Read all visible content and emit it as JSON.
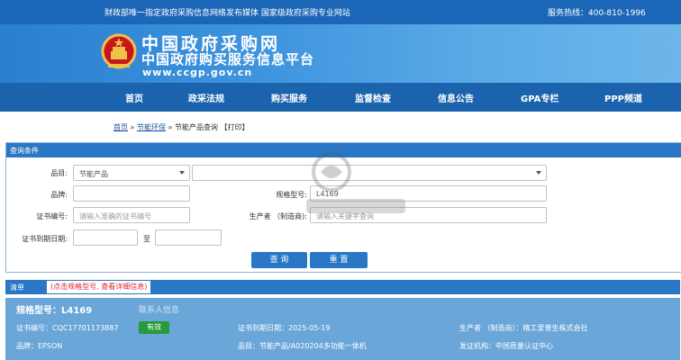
{
  "topbar": {
    "notice": "财政部唯一指定政府采购信息网络发布媒体 国家级政府采购专业网站",
    "hotline": "服务热线：400-810-1996"
  },
  "banner": {
    "title": "中国政府采购网",
    "subtitle": "中国政府购买服务信息平台",
    "url": "www.ccgp.gov.cn"
  },
  "nav": {
    "items": [
      "首页",
      "政采法规",
      "购买服务",
      "监督检查",
      "信息公告",
      "GPA专栏",
      "PPP频道"
    ]
  },
  "breadcrumb": {
    "home": "首页",
    "sep1": "»",
    "section": "节能环保",
    "sep2": "»",
    "page": "节能产品查询",
    "print": "【打印】"
  },
  "query": {
    "header": "查询条件",
    "category_label": "品目:",
    "category_value": "节能产品",
    "subcategory_value": "",
    "brand_label": "品牌:",
    "brand_value": "",
    "model_label": "规格型号:",
    "model_value": "L4169",
    "cert_label": "证书编号:",
    "cert_placeholder": "请输入准确的证书编号",
    "maker_label": "生产者 （制造商):",
    "maker_placeholder": "请输入关键字查询",
    "expiry_label": "证书到期日期:",
    "expiry_from": "",
    "to_label": "至",
    "expiry_to": "",
    "search_button": "查 询",
    "reset_button": "重 置"
  },
  "list": {
    "header": "清单",
    "note": "(点击规格型号, 查看详细信息)"
  },
  "result": {
    "model": "规格型号：L4169",
    "contact": "联系人信息",
    "cert_no": "证书编号：CQC17701173887",
    "status": "有效",
    "expiry": "证书到期日期：2025-05-19",
    "maker": "生产者 （制造商）：精工爱普生株式会社",
    "brand": "品牌：EPSON",
    "category": "品目：节能产品/A020204多功能一体机",
    "issuer": "发证机构：中国质量认证中心"
  },
  "colors": {
    "topbar": "#1b66b6",
    "nav": "#1b63ad",
    "panel_head": "#2a77c5",
    "card": "#6aa6d8",
    "badge": "#279a3d",
    "note_red": "#d7282d"
  }
}
